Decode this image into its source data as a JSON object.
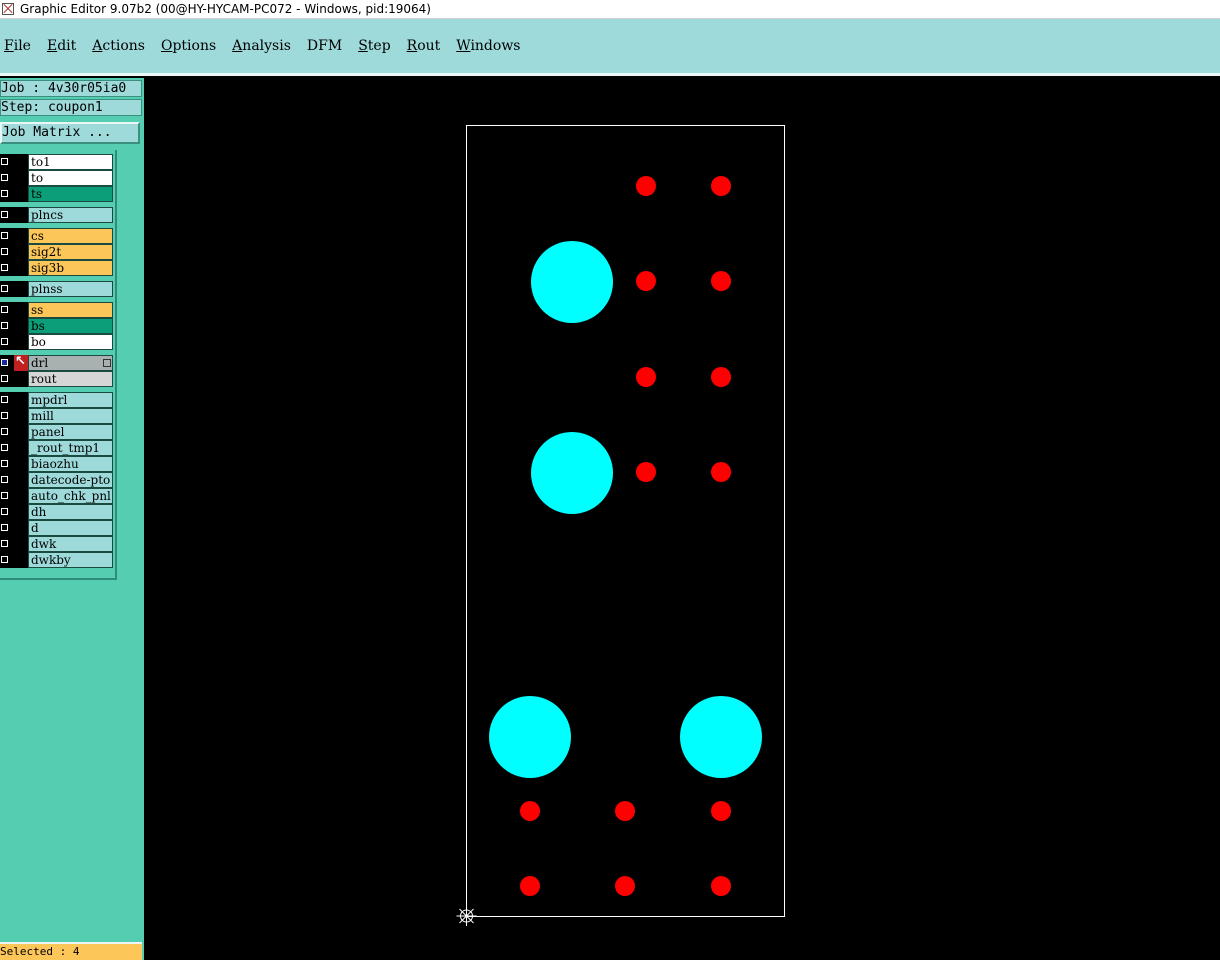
{
  "window": {
    "title": "Graphic Editor 9.07b2 (00@HY-HYCAM-PC072 - Windows, pid:19064)"
  },
  "menu": [
    {
      "label": "File",
      "ul": "F",
      "rest": "ile"
    },
    {
      "label": "Edit",
      "ul": "E",
      "rest": "dit"
    },
    {
      "label": "Actions",
      "ul": "A",
      "rest": "ctions"
    },
    {
      "label": "Options",
      "ul": "O",
      "rest": "ptions"
    },
    {
      "label": "Analysis",
      "ul": "A",
      "rest": "nalysis"
    },
    {
      "label": "DFM",
      "ul": "",
      "rest": "DFM"
    },
    {
      "label": "Step",
      "ul": "S",
      "rest": "tep"
    },
    {
      "label": "Rout",
      "ul": "R",
      "rest": "out"
    },
    {
      "label": "Windows",
      "ul": "W",
      "rest": "indows"
    }
  ],
  "left_panel": {
    "job": "Job : 4v30r05ia0",
    "step": "Step: coupon1",
    "job_matrix": "Job Matrix ..."
  },
  "layers": [
    {
      "name": "to1",
      "color": "white"
    },
    {
      "name": "to",
      "color": "white"
    },
    {
      "name": "ts",
      "color": "teal"
    },
    {
      "name": "plncs",
      "color": "cyan"
    },
    {
      "name": "cs",
      "color": "orange"
    },
    {
      "name": "sig2t",
      "color": "orange"
    },
    {
      "name": "sig3b",
      "color": "orange"
    },
    {
      "name": "plnss",
      "color": "cyan"
    },
    {
      "name": "ss",
      "color": "orange"
    },
    {
      "name": "bs",
      "color": "teal"
    },
    {
      "name": "bo",
      "color": "white"
    },
    {
      "name": "drl",
      "color": "gray",
      "active": true
    },
    {
      "name": "rout",
      "color": "lgray"
    },
    {
      "name": "mpdrl",
      "color": "cyan"
    },
    {
      "name": "mill",
      "color": "cyan"
    },
    {
      "name": "panel",
      "color": "cyan"
    },
    {
      "name": "_rout_tmp1",
      "color": "cyan"
    },
    {
      "name": "biaozhu",
      "color": "cyan"
    },
    {
      "name": "datecode-pto",
      "color": "cyan"
    },
    {
      "name": "auto_chk_pnl",
      "color": "cyan"
    },
    {
      "name": "dh",
      "color": "cyan"
    },
    {
      "name": "d",
      "color": "cyan"
    },
    {
      "name": "dwk",
      "color": "cyan"
    },
    {
      "name": "dwkby",
      "color": "cyan"
    }
  ],
  "status": {
    "selected": "Selected : 4"
  },
  "colors": {
    "large_pad": "#00ffff",
    "small_pad": "#ff0000",
    "profile": "#ffffff",
    "background": "#000000"
  },
  "canvas": {
    "large_pads": 4,
    "small_pads": 14,
    "origin_marker": "origin-crosshair-icon"
  }
}
